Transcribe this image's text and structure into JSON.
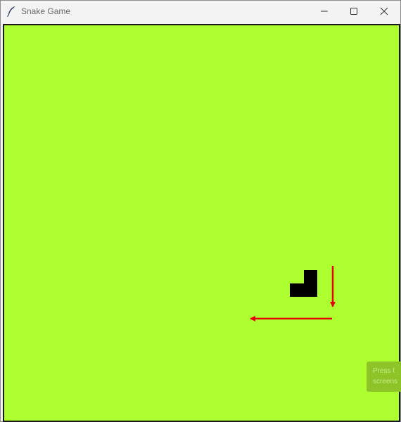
{
  "window": {
    "title": "Snake Game",
    "icon": "feather-icon",
    "controls": {
      "minimize_icon": "minimize-icon",
      "maximize_icon": "maximize-icon",
      "close_icon": "close-icon"
    }
  },
  "game": {
    "background_color": "#adff2f",
    "snake_color": "#000000",
    "annotation_color": "#e60000",
    "annotations": [
      "arrow-down-icon",
      "arrow-left-icon"
    ]
  },
  "overlay": {
    "line1": "Press t",
    "line2": "screens"
  }
}
